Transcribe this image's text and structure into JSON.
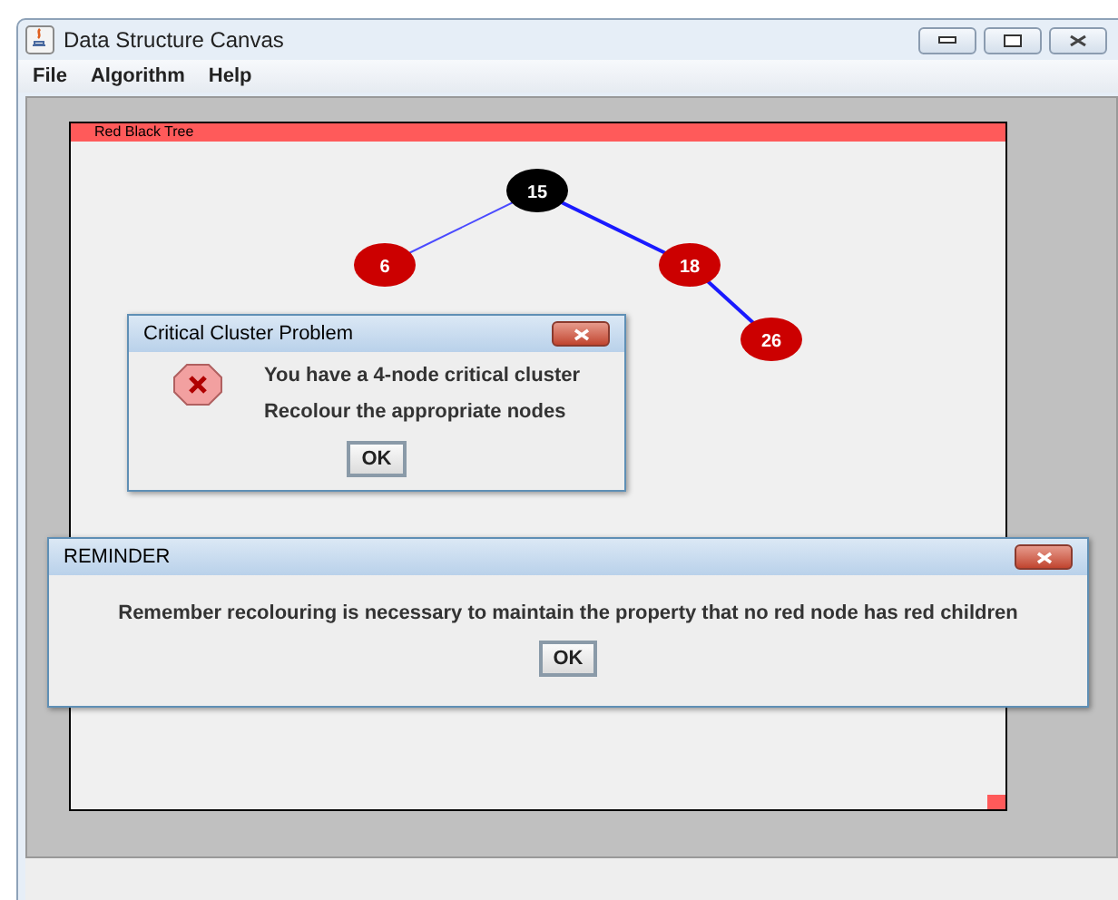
{
  "window": {
    "title": "Data Structure Canvas"
  },
  "menu": [
    "File",
    "Algorithm",
    "Help"
  ],
  "canvas": {
    "title": "Red Black Tree",
    "tree": {
      "label": "15",
      "color": "#000000",
      "children": [
        {
          "label": "6",
          "color": "#cc0000",
          "kind": "left",
          "edge_highlighted": false
        },
        {
          "label": "18",
          "color": "#cc0000",
          "kind": "right",
          "edge_highlighted": true,
          "children": [
            {
              "label": "26",
              "color": "#cc0000",
              "kind": "right",
              "edge_highlighted": true
            }
          ]
        }
      ]
    }
  },
  "dialogs": [
    {
      "title": "Critical Cluster Problem",
      "kind": "error",
      "lines": [
        "You have a 4-node critical cluster",
        "Recolour the appropriate nodes"
      ],
      "button": "OK"
    },
    {
      "title": "REMINDER",
      "kind": "plain",
      "lines": [
        "Remember recolouring is necessary to maintain the property that no red node has red children"
      ],
      "button": "OK"
    }
  ]
}
